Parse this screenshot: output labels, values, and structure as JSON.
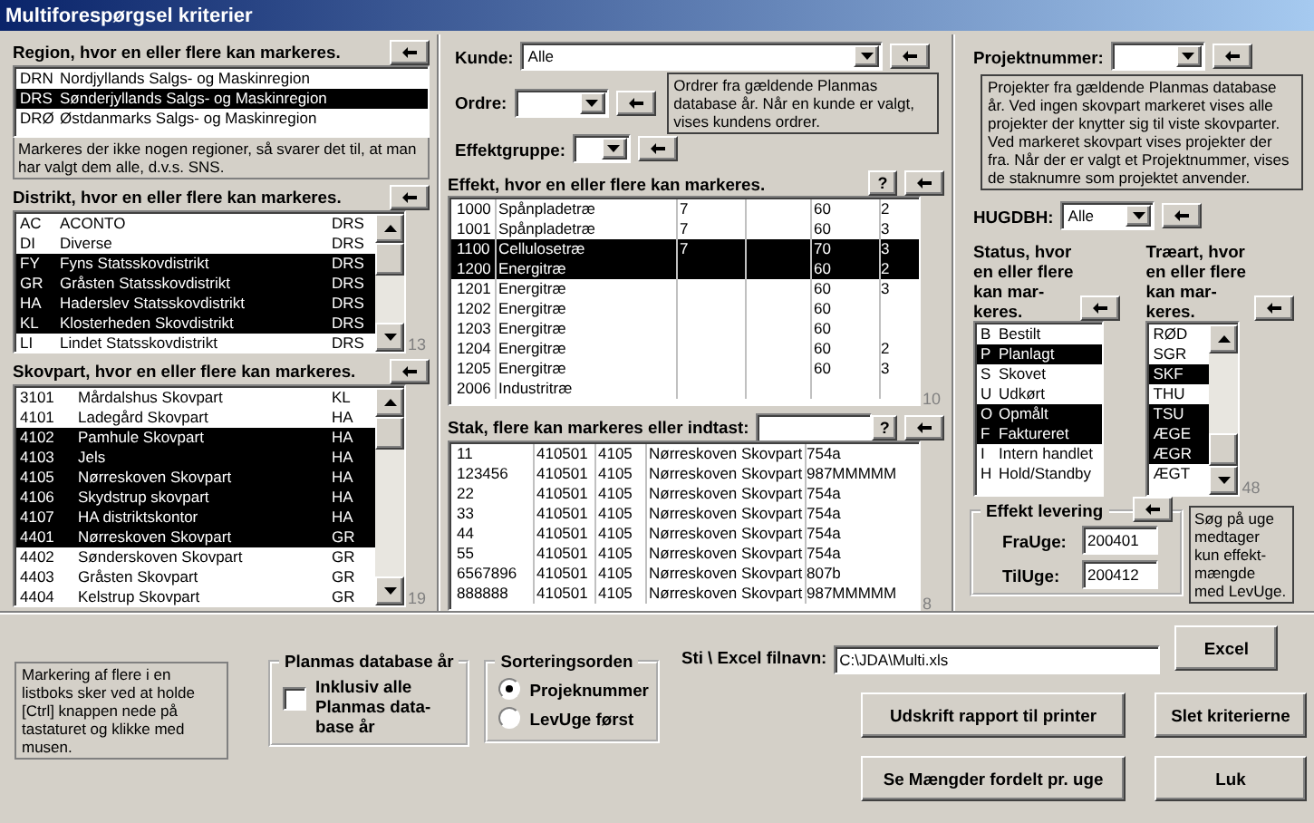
{
  "window": {
    "title": "Multiforespørgsel kriterier"
  },
  "region": {
    "header": "Region, hvor en eller flere kan markeres.",
    "rows": [
      {
        "code": "DRN",
        "name": "Nordjyllands Salgs- og Maskinregion",
        "selected": false
      },
      {
        "code": "DRS",
        "name": "Sønderjyllands Salgs- og Maskinregion",
        "selected": true
      },
      {
        "code": "DRØ",
        "name": "Østdanmarks Salgs- og Maskinregion",
        "selected": false
      }
    ],
    "note": "Markeres der ikke nogen regioner, så svarer det til, at man har valgt dem alle, d.v.s. SNS."
  },
  "distrikt": {
    "header": "Distrikt, hvor en eller flere kan markeres.",
    "count": "13",
    "rows": [
      {
        "code": "AC",
        "name": "ACONTO",
        "region": "DRS",
        "selected": false
      },
      {
        "code": "DI",
        "name": "Diverse",
        "region": "DRS",
        "selected": false
      },
      {
        "code": "FY",
        "name": "Fyns Statsskovdistrikt",
        "region": "DRS",
        "selected": true
      },
      {
        "code": "GR",
        "name": "Gråsten Statsskovdistrikt",
        "region": "DRS",
        "selected": true
      },
      {
        "code": "HA",
        "name": "Haderslev Statsskovdistrikt",
        "region": "DRS",
        "selected": true
      },
      {
        "code": "KL",
        "name": "Klosterheden Skovdistrikt",
        "region": "DRS",
        "selected": true
      },
      {
        "code": "LI",
        "name": "Lindet Statsskovdistrikt",
        "region": "DRS",
        "selected": false
      }
    ]
  },
  "skovpart": {
    "header": "Skovpart, hvor en eller flere kan markeres.",
    "count": "19",
    "rows": [
      {
        "code": "3101",
        "name": "Mårdalshus Skovpart",
        "distrikt": "KL",
        "selected": false
      },
      {
        "code": "4101",
        "name": "Ladegård Skovpart",
        "distrikt": "HA",
        "selected": false
      },
      {
        "code": "4102",
        "name": "Pamhule Skovpart",
        "distrikt": "HA",
        "selected": true
      },
      {
        "code": "4103",
        "name": "Jels",
        "distrikt": "HA",
        "selected": true
      },
      {
        "code": "4105",
        "name": "Nørreskoven Skovpart",
        "distrikt": "HA",
        "selected": true
      },
      {
        "code": "4106",
        "name": "Skydstrup skovpart",
        "distrikt": "HA",
        "selected": true
      },
      {
        "code": "4107",
        "name": "HA distriktskontor",
        "distrikt": "HA",
        "selected": true
      },
      {
        "code": "4401",
        "name": "Nørreskoven Skovpart",
        "distrikt": "GR",
        "selected": true
      },
      {
        "code": "4402",
        "name": "Sønderskoven Skovpart",
        "distrikt": "GR",
        "selected": false
      },
      {
        "code": "4403",
        "name": "Gråsten Skovpart",
        "distrikt": "GR",
        "selected": false
      },
      {
        "code": "4404",
        "name": "Kelstrup Skovpart",
        "distrikt": "GR",
        "selected": false
      }
    ]
  },
  "kunde": {
    "label": "Kunde:",
    "value": "Alle"
  },
  "ordre": {
    "label": "Ordre:",
    "note": "Ordrer fra gældende Planmas database år. Når en kunde er valgt, vises kundens ordrer."
  },
  "effektgruppe": {
    "label": "Effektgruppe:"
  },
  "effekt": {
    "header": "Effekt, hvor en eller flere kan markeres.",
    "help": "?",
    "count": "10",
    "rows": [
      {
        "code": "1000",
        "name": "Spånpladetræ",
        "column_3": "7",
        "column_5": "60",
        "column_6": "2",
        "selected": false
      },
      {
        "code": "1001",
        "name": "Spånpladetræ",
        "column_3": "7",
        "column_5": "60",
        "column_6": "3",
        "selected": false
      },
      {
        "code": "1100",
        "name": "Cellulosetræ",
        "column_3": "7",
        "column_5": "70",
        "column_6": "3",
        "selected": true
      },
      {
        "code": "1200",
        "name": "Energitræ",
        "column_5": "60",
        "column_6": "2",
        "selected": true
      },
      {
        "code": "1201",
        "name": "Energitræ",
        "column_5": "60",
        "column_6": "3",
        "selected": false
      },
      {
        "code": "1202",
        "name": "Energitræ",
        "column_5": "60",
        "selected": false
      },
      {
        "code": "1203",
        "name": "Energitræ",
        "column_5": "60",
        "selected": false
      },
      {
        "code": "1204",
        "name": "Energitræ",
        "column_5": "60",
        "column_6": "2",
        "selected": false
      },
      {
        "code": "1205",
        "name": "Energitræ",
        "column_5": "60",
        "column_6": "3",
        "selected": false
      },
      {
        "code": "2006",
        "name": "Industritræ",
        "selected": false
      }
    ]
  },
  "stak": {
    "header": "Stak, flere kan markeres eller indtast:",
    "help": "?",
    "count": "8",
    "rows": [
      {
        "stak": "11",
        "column_2": "410501",
        "column_3": "4105",
        "column_4": "Nørreskoven Skovpart",
        "column_5": "754a",
        "selected": false
      },
      {
        "stak": "123456",
        "column_2": "410501",
        "column_3": "4105",
        "column_4": "Nørreskoven Skovpart",
        "column_5": "987MMMMM",
        "selected": false
      },
      {
        "stak": "22",
        "column_2": "410501",
        "column_3": "4105",
        "column_4": "Nørreskoven Skovpart",
        "column_5": "754a",
        "selected": false
      },
      {
        "stak": "33",
        "column_2": "410501",
        "column_3": "4105",
        "column_4": "Nørreskoven Skovpart",
        "column_5": "754a",
        "selected": false
      },
      {
        "stak": "44",
        "column_2": "410501",
        "column_3": "4105",
        "column_4": "Nørreskoven Skovpart",
        "column_5": "754a",
        "selected": false
      },
      {
        "stak": "55",
        "column_2": "410501",
        "column_3": "4105",
        "column_4": "Nørreskoven Skovpart",
        "column_5": "754a",
        "selected": false
      },
      {
        "stak": "6567896",
        "column_2": "410501",
        "column_3": "4105",
        "column_4": "Nørreskoven Skovpart",
        "column_5": "807b",
        "selected": false
      },
      {
        "stak": "888888",
        "column_2": "410501",
        "column_3": "4105",
        "column_4": "Nørreskoven Skovpart",
        "column_5": "987MMMMM",
        "selected": false
      }
    ]
  },
  "projekt": {
    "label": "Projektnummer:",
    "note": "Projekter fra gældende Planmas database år. Ved ingen skovpart markeret vises alle projekter der knytter sig til viste skovparter. Ved markeret skovpart vises projekter der fra. Når der er valgt et Projektnummer, vises de staknumre som projektet anvender."
  },
  "hugdbh": {
    "label": "HUGDBH:",
    "value": "Alle"
  },
  "status": {
    "header_lines": [
      "Status, hvor",
      "en eller flere",
      "kan mar-",
      "keres."
    ],
    "rows": [
      {
        "code": "B",
        "name": "Bestilt",
        "selected": false
      },
      {
        "code": "P",
        "name": "Planlagt",
        "selected": true
      },
      {
        "code": "S",
        "name": "Skovet",
        "selected": false
      },
      {
        "code": "U",
        "name": "Udkørt",
        "selected": false
      },
      {
        "code": "O",
        "name": "Opmålt",
        "selected": true
      },
      {
        "code": "F",
        "name": "Faktureret",
        "selected": true
      },
      {
        "code": "I",
        "name": "Intern handlet",
        "selected": false
      },
      {
        "code": "H",
        "name": "Hold/Standby",
        "selected": false
      }
    ]
  },
  "traeart": {
    "header_lines": [
      "Træart, hvor",
      "en eller flere",
      "kan mar-",
      "keres."
    ],
    "count": "48",
    "rows": [
      {
        "code": "RØD",
        "selected": false
      },
      {
        "code": "SGR",
        "selected": false
      },
      {
        "code": "SKF",
        "selected": true
      },
      {
        "code": "THU",
        "selected": false
      },
      {
        "code": "TSU",
        "selected": true
      },
      {
        "code": "ÆGE",
        "selected": true
      },
      {
        "code": "ÆGR",
        "selected": true
      },
      {
        "code": "ÆGT",
        "selected": false
      }
    ]
  },
  "levering": {
    "title": "Effekt levering",
    "fra_label": "FraUge:",
    "fra": "200401",
    "til_label": "TilUge:",
    "til": "200412",
    "note_lines": [
      "Søg på uge",
      "medtager",
      "kun effekt-",
      "mængde",
      "med LevUge."
    ]
  },
  "bottom_note": "Markering af flere i en listboks sker ved at holde [Ctrl] knappen nede på tastaturet og klikke med musen.",
  "planmas": {
    "title": "Planmas database år",
    "checkbox_lines": [
      "Inklusiv alle",
      "Planmas data-",
      "base år"
    ],
    "checked": false
  },
  "sortering": {
    "title": "Sorteringsorden",
    "options": [
      {
        "label": "Projeknummer",
        "selected": true
      },
      {
        "label": "LevUge først",
        "selected": false
      }
    ]
  },
  "sti": {
    "label": "Sti \\ Excel filnavn:",
    "value": "C:\\JDA\\Multi.xls"
  },
  "buttons": {
    "excel": "Excel",
    "print": "Udskrift rapport til printer",
    "clear": "Slet kriterierne",
    "weekly": "Se Mængder fordelt pr. uge",
    "close": "Luk"
  }
}
